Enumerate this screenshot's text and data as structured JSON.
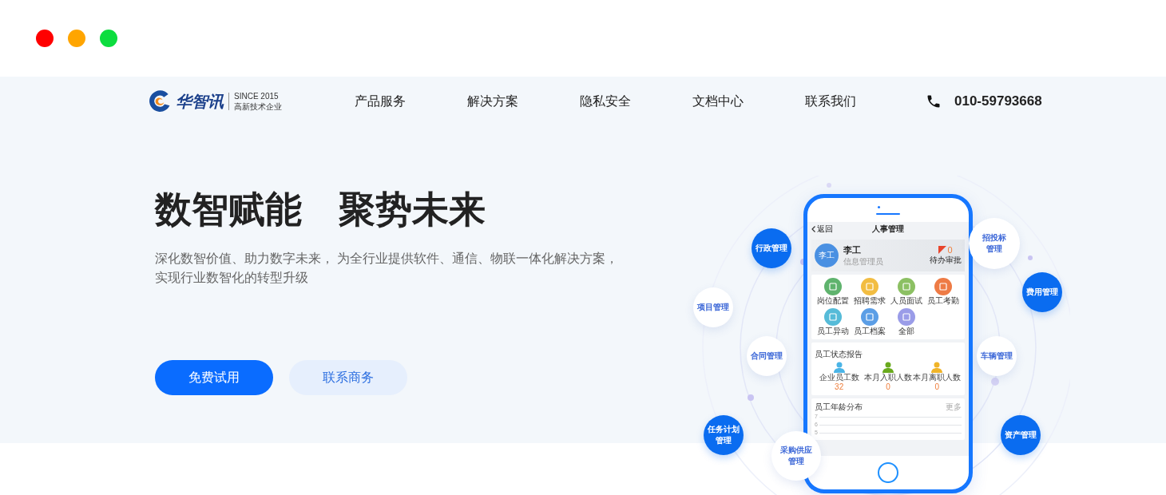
{
  "window_controls": [
    {
      "color": "#ff0000"
    },
    {
      "color": "#ffa500"
    },
    {
      "color": "#0ddd3f"
    }
  ],
  "brand": {
    "name": "华智讯",
    "since": "SINCE 2015",
    "tagline": "高新技术企业"
  },
  "nav": {
    "items": [
      "产品服务",
      "解决方案",
      "隐私安全",
      "文档中心",
      "联系我们"
    ],
    "phone": "010-59793668"
  },
  "hero": {
    "title_parts": [
      "数智赋能",
      "聚势未来"
    ],
    "subtitle_lines": [
      "深化数智价值、助力数字未来， 为全行业提供软件、通信、物联一体化解决方案，",
      "实现行业数智化的转型升级"
    ],
    "buttons": [
      {
        "label": "免费试用",
        "kind": "primary"
      },
      {
        "label": "联系商务",
        "kind": "secondary"
      }
    ]
  },
  "phone_mockup": {
    "back": "返回",
    "title": "人事管理",
    "avatar": "李工",
    "user": "李工",
    "role": "信息管理员",
    "pending_count": "0",
    "pending_label": "待办审批",
    "modules": [
      {
        "label": "岗位配置",
        "color": "#5fb36d"
      },
      {
        "label": "招聘需求",
        "color": "#f2bd42"
      },
      {
        "label": "人员面试",
        "color": "#8cc063"
      },
      {
        "label": "员工考勤",
        "color": "#ee7b45"
      },
      {
        "label": "员工异动",
        "color": "#56bbd8"
      },
      {
        "label": "员工档案",
        "color": "#5b9ee6"
      },
      {
        "label": "全部",
        "color": "#9a9ce8"
      }
    ],
    "status_card": {
      "title": "员工状态报告",
      "stats": [
        {
          "label": "企业员工数",
          "value": "32",
          "color": "#4bb4e6"
        },
        {
          "label": "本月入职人数",
          "value": "0",
          "color": "#6aaa1e"
        },
        {
          "label": "本月离职人数",
          "value": "0",
          "color": "#f0b429"
        }
      ]
    },
    "age_card": {
      "title": "员工年龄分布",
      "more": "更多",
      "axis_labels": [
        "7",
        "6",
        "5"
      ]
    }
  },
  "orbit_bubbles": [
    {
      "label": "行政管理",
      "kind": "filled"
    },
    {
      "label": "项目管理",
      "kind": "plain"
    },
    {
      "label": "合同管理",
      "kind": "plain"
    },
    {
      "label": "任务计划管理",
      "kind": "filled"
    },
    {
      "label": "采购供应管理",
      "kind": "plain"
    },
    {
      "label": "招投标管理",
      "kind": "plain"
    },
    {
      "label": "费用管理",
      "kind": "filled"
    },
    {
      "label": "车辆管理",
      "kind": "plain"
    },
    {
      "label": "资产管理",
      "kind": "filled"
    }
  ]
}
